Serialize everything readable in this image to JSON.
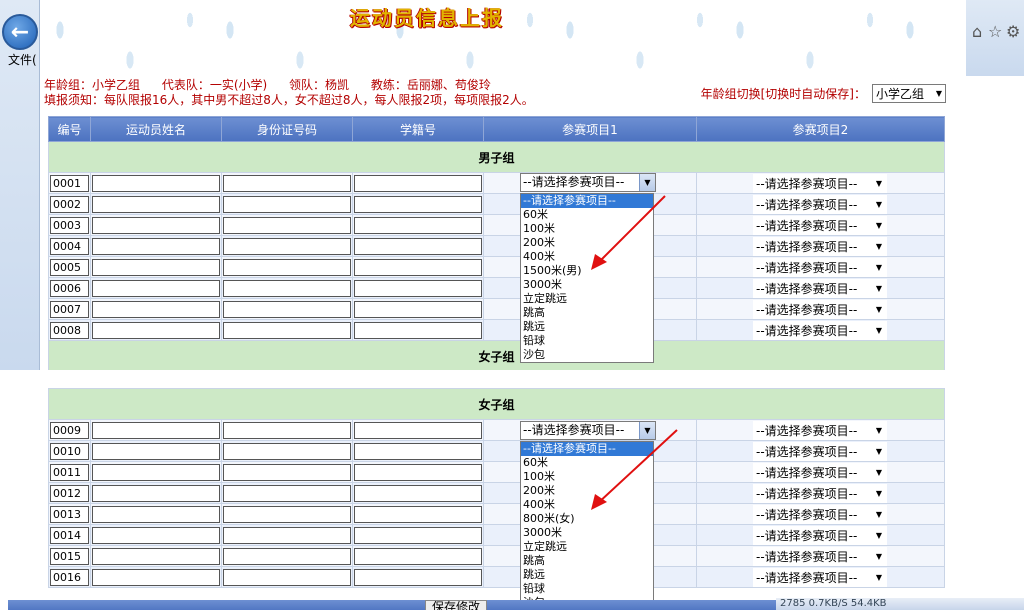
{
  "browser": {
    "file_menu": "文件(",
    "back_icon": "back-arrow-icon"
  },
  "page": {
    "title": "运动员信息上报",
    "info_line1": [
      "年龄组：小学乙组",
      "代表队：一实(小学)",
      "领队：杨凯",
      "教练：岳丽娜、苟俊玲"
    ],
    "info_line2": "填报须知：每队限报16人，其中男不超过8人，女不超过8人，每人限报2项，每项限报2人。",
    "switch_label": "年龄组切换[切换时自动保存]：",
    "switch_value": "小学乙组"
  },
  "table": {
    "headers": [
      "编号",
      "运动员姓名",
      "身份证号码",
      "学籍号",
      "参赛项目1",
      "参赛项目2"
    ],
    "male_group": "男子组",
    "female_group": "女子组",
    "placeholder": "--请选择参赛项目--",
    "male_rows": [
      "0001",
      "0002",
      "0003",
      "0004",
      "0005",
      "0006",
      "0007",
      "0008"
    ],
    "female_rows": [
      "0009",
      "0010",
      "0011",
      "0012",
      "0013",
      "0014",
      "0015",
      "0016"
    ]
  },
  "dropdown_male": [
    "--请选择参赛项目--",
    "60米",
    "100米",
    "200米",
    "400米",
    "1500米(男)",
    "3000米",
    "立定跳远",
    "跳高",
    "跳远",
    "铅球",
    "沙包"
  ],
  "dropdown_female": [
    "--请选择参赛项目--",
    "60米",
    "100米",
    "200米",
    "400米",
    "800米(女)",
    "3000米",
    "立定跳远",
    "跳高",
    "跳远",
    "铅球",
    "沙包"
  ],
  "footer": {
    "save_label": "保存修改",
    "status": "2785  0.7KB/S  54.4KB"
  },
  "colors": {
    "accent": "#b30000",
    "header": "#4c72c0",
    "group": "#cde9c6",
    "arrow": "#e01010"
  }
}
